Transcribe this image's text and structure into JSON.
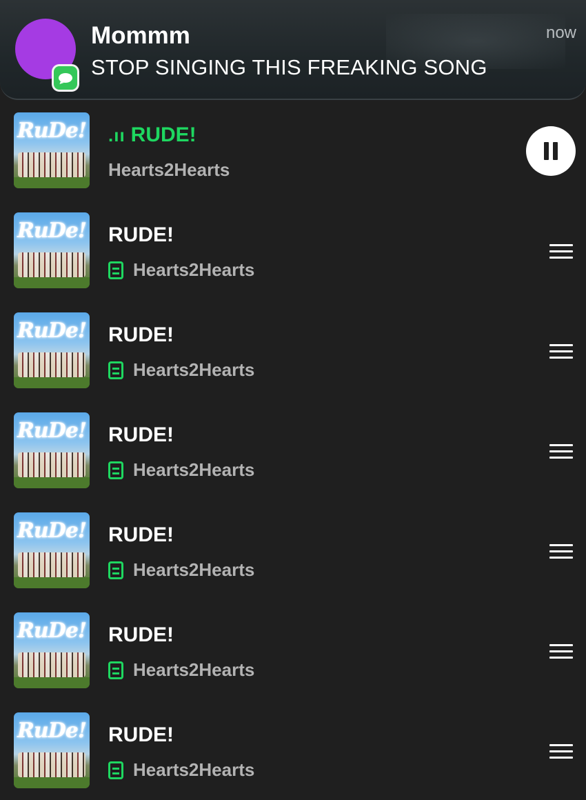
{
  "notification": {
    "sender": "Mommm",
    "message": "STOP SINGING THIS FREAKING SONG",
    "time": "now",
    "avatar_color": "#a53be3",
    "app_icon": "messages-icon",
    "app_icon_color": "#34c759"
  },
  "player": {
    "now_playing_indicator": ".ıı",
    "accent_color": "#1ed760",
    "pause_icon": "pause-icon"
  },
  "tracks": [
    {
      "title": "RUDE!",
      "artist": "Hearts2Hearts",
      "art_text": "RuDe!",
      "playing": true
    },
    {
      "title": "RUDE!",
      "artist": "Hearts2Hearts",
      "art_text": "RuDe!",
      "downloaded": true
    },
    {
      "title": "RUDE!",
      "artist": "Hearts2Hearts",
      "art_text": "RuDe!",
      "downloaded": true
    },
    {
      "title": "RUDE!",
      "artist": "Hearts2Hearts",
      "art_text": "RuDe!",
      "downloaded": true
    },
    {
      "title": "RUDE!",
      "artist": "Hearts2Hearts",
      "art_text": "RuDe!",
      "downloaded": true
    },
    {
      "title": "RUDE!",
      "artist": "Hearts2Hearts",
      "art_text": "RuDe!",
      "downloaded": true
    },
    {
      "title": "RUDE!",
      "artist": "Hearts2Hearts",
      "art_text": "RuDe!",
      "downloaded": true
    }
  ]
}
